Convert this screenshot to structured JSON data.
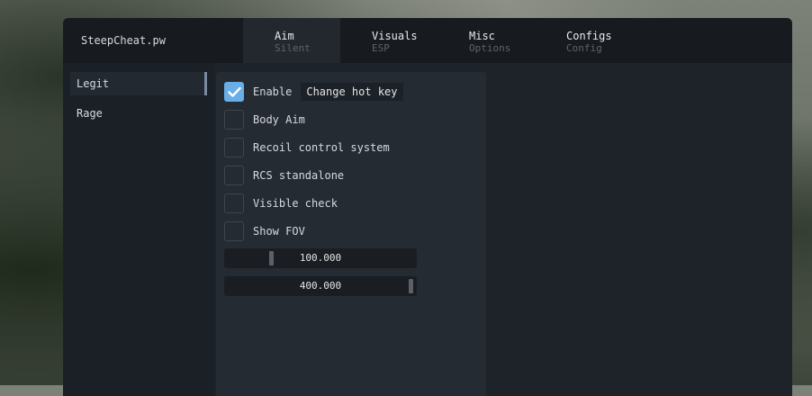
{
  "app": {
    "title": "SteepCheat.pw"
  },
  "tabs": [
    {
      "label": "Aim",
      "sub": "Silent",
      "active": true
    },
    {
      "label": "Visuals",
      "sub": "ESP",
      "active": false
    },
    {
      "label": "Misc",
      "sub": "Options",
      "active": false
    },
    {
      "label": "Configs",
      "sub": "Config",
      "active": false
    }
  ],
  "sidebar": {
    "items": [
      {
        "label": "Legit",
        "active": true
      },
      {
        "label": "Rage",
        "active": false
      }
    ]
  },
  "options": [
    {
      "label": "Enable",
      "checked": true,
      "hotkey": "Change hot key"
    },
    {
      "label": "Body Aim",
      "checked": false
    },
    {
      "label": "Recoil control system",
      "checked": false
    },
    {
      "label": "RCS standalone",
      "checked": false
    },
    {
      "label": "Visible check",
      "checked": false
    },
    {
      "label": "Show FOV",
      "checked": false
    }
  ],
  "sliders": [
    {
      "value_text": "100.000",
      "fraction": 0.25
    },
    {
      "value_text": "400.000",
      "fraction": 1.0
    }
  ],
  "colors": {
    "accent": "#6aaee8",
    "window_bg": "#1e232a",
    "titlebar_bg": "#171b20"
  }
}
